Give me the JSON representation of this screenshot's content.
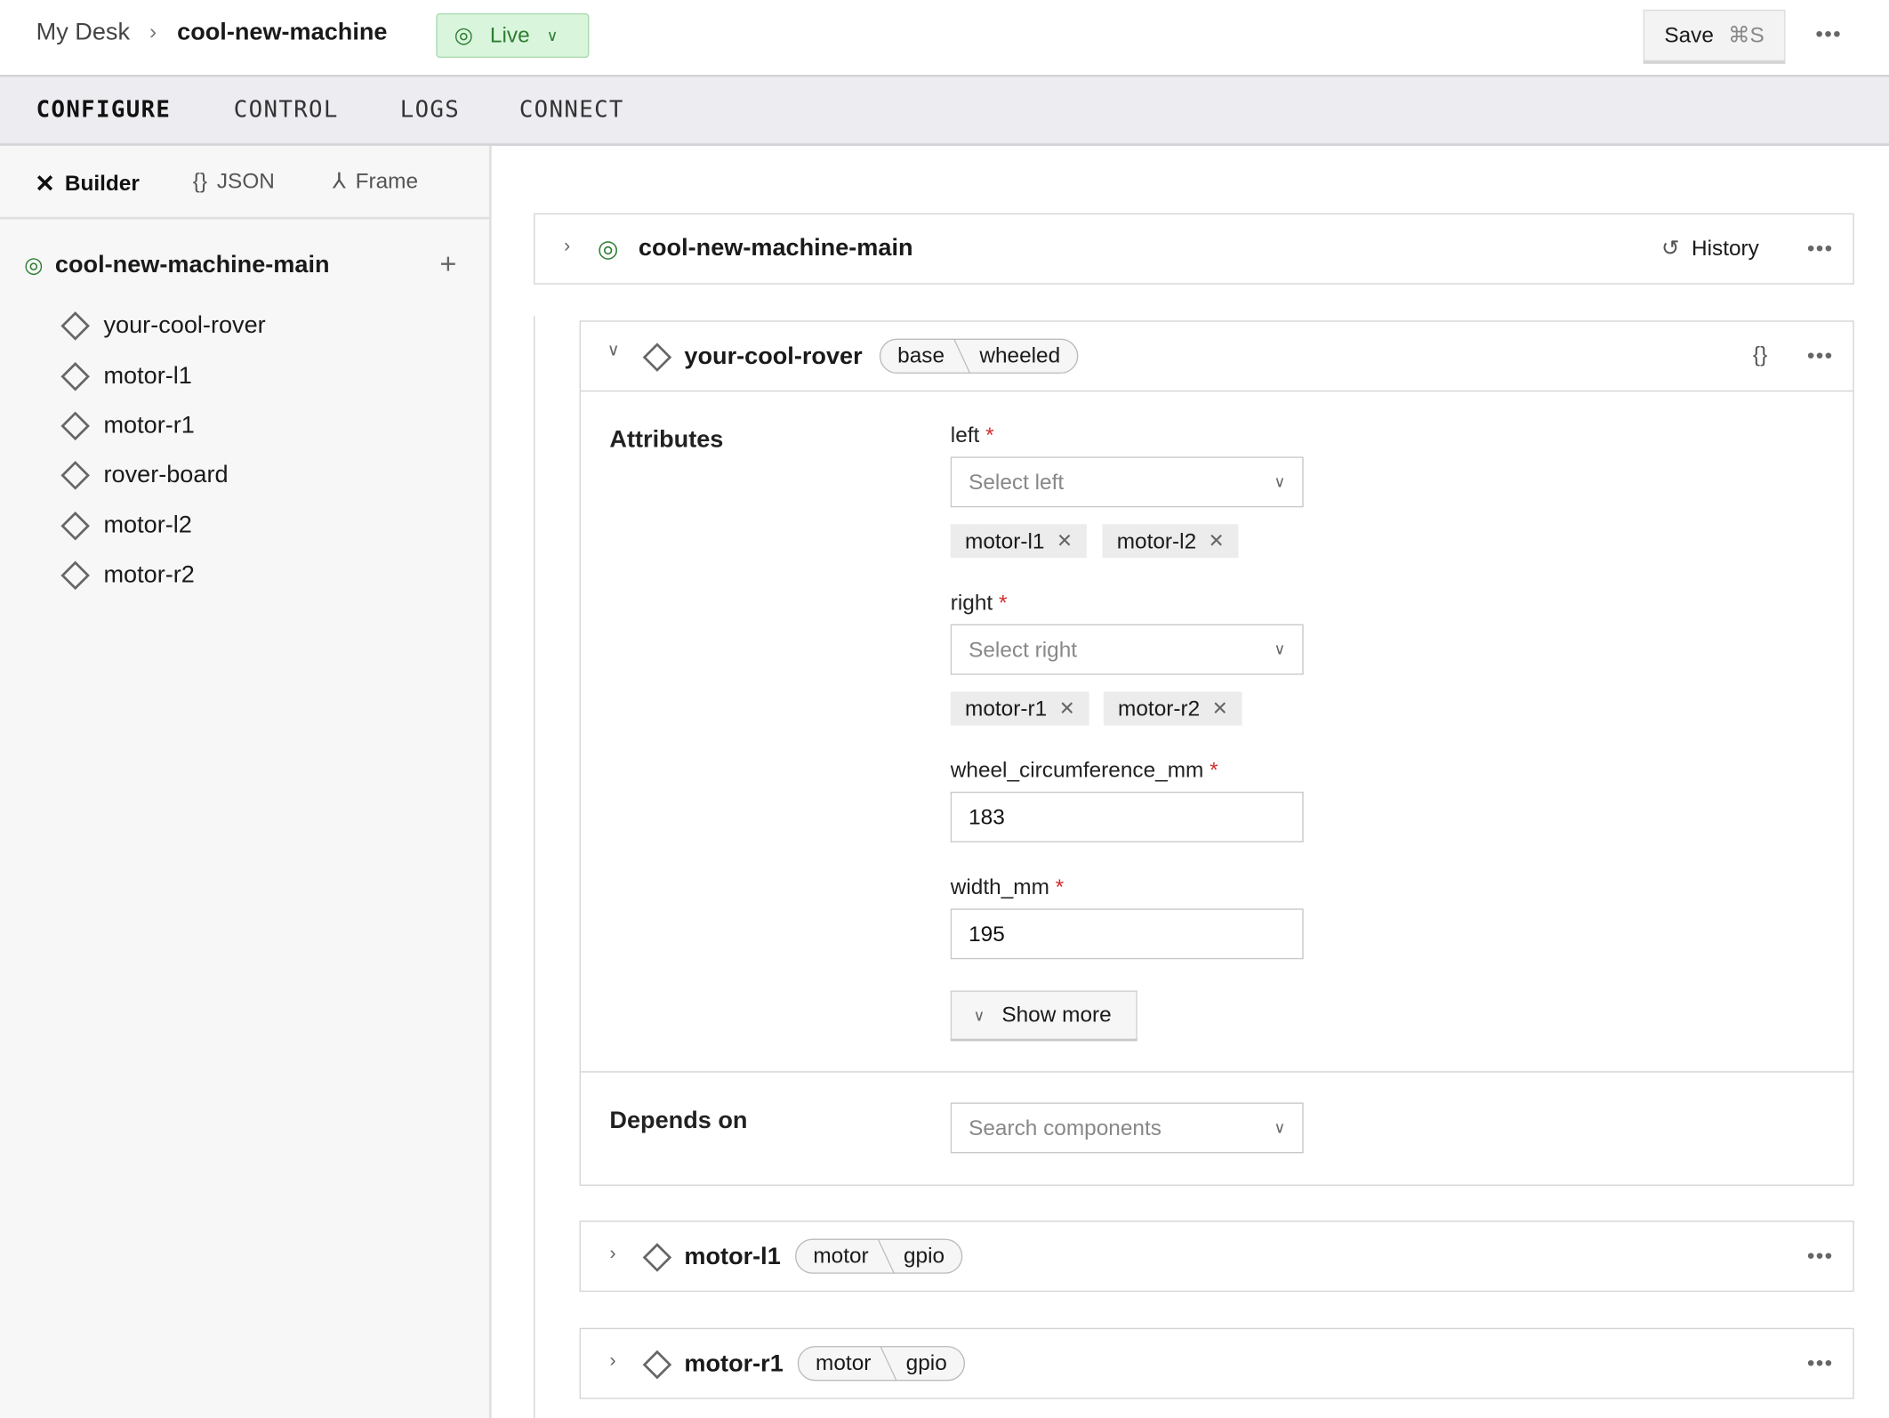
{
  "header": {
    "breadcrumb_root": "My Desk",
    "breadcrumb_current": "cool-new-machine",
    "status_label": "Live",
    "save_label": "Save",
    "save_shortcut": "⌘S",
    "status_color": "#2e7d32"
  },
  "tabs": [
    {
      "label": "CONFIGURE",
      "active": true
    },
    {
      "label": "CONTROL"
    },
    {
      "label": "LOGS"
    },
    {
      "label": "CONNECT"
    }
  ],
  "sidebar": {
    "subtabs": [
      {
        "label": "Builder",
        "active": true
      },
      {
        "label": "JSON"
      },
      {
        "label": "Frame"
      }
    ],
    "root": "cool-new-machine-main",
    "items": [
      "your-cool-rover",
      "motor-l1",
      "motor-r1",
      "rover-board",
      "motor-l2",
      "motor-r2"
    ]
  },
  "main": {
    "part": {
      "title": "cool-new-machine-main",
      "history_label": "History"
    },
    "rover": {
      "title": "your-cool-rover",
      "type": "base",
      "model": "wheeled",
      "attributes_label": "Attributes",
      "left": {
        "label": "left",
        "placeholder": "Select left",
        "chips": [
          "motor-l1",
          "motor-l2"
        ]
      },
      "right": {
        "label": "right",
        "placeholder": "Select right",
        "chips": [
          "motor-r1",
          "motor-r2"
        ]
      },
      "wheel": {
        "label": "wheel_circumference_mm",
        "value": "183"
      },
      "width": {
        "label": "width_mm",
        "value": "195"
      },
      "show_more": "Show more",
      "depends_label": "Depends on",
      "depends_placeholder": "Search components"
    },
    "collapsed": [
      {
        "title": "motor-l1",
        "type": "motor",
        "model": "gpio"
      },
      {
        "title": "motor-r1",
        "type": "motor",
        "model": "gpio"
      }
    ]
  }
}
